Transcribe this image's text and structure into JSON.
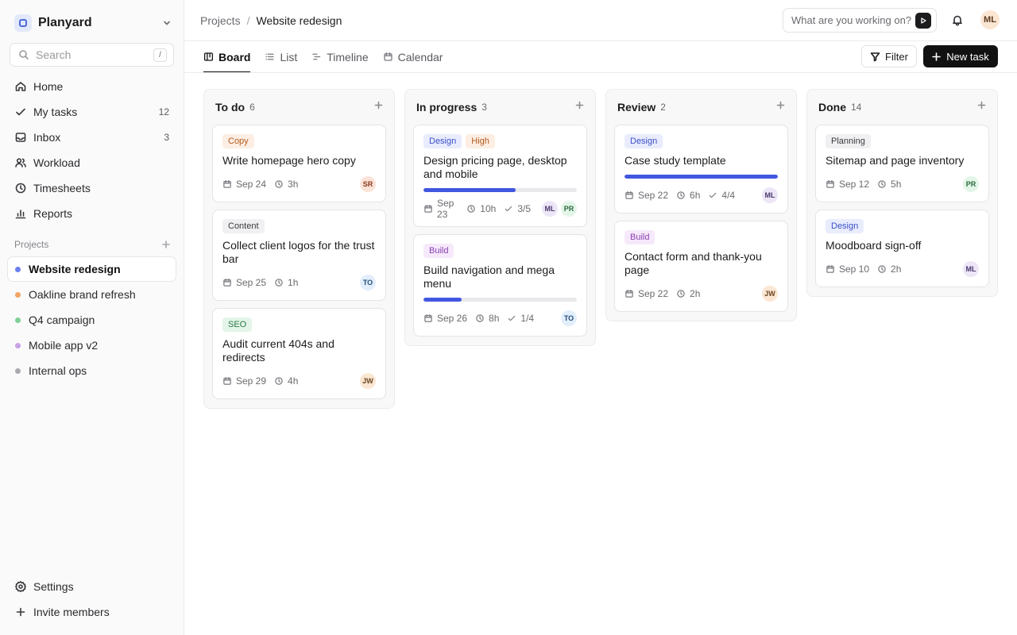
{
  "workspace": {
    "name": "Planyard",
    "logo_icon": "square-logo-icon"
  },
  "search": {
    "placeholder": "Search",
    "shortcut": "/"
  },
  "nav": [
    {
      "label": "Home",
      "icon": "home-icon"
    },
    {
      "label": "My tasks",
      "icon": "check-icon",
      "count": "12"
    },
    {
      "label": "Inbox",
      "icon": "inbox-icon",
      "count": "3"
    },
    {
      "label": "Workload",
      "icon": "users-icon"
    },
    {
      "label": "Timesheets",
      "icon": "clock-icon"
    },
    {
      "label": "Reports",
      "icon": "bar-chart-icon"
    }
  ],
  "projects_section": {
    "label": "Projects"
  },
  "projects": [
    {
      "name": "Website redesign",
      "color": "#6b7ff0",
      "active": true
    },
    {
      "name": "Oakline brand refresh",
      "color": "#f0a467",
      "active": false
    },
    {
      "name": "Q4 campaign",
      "color": "#7fcf96",
      "active": false
    },
    {
      "name": "Mobile app v2",
      "color": "#c7a2e6",
      "active": false
    },
    {
      "name": "Internal ops",
      "color": "#a9a9ae",
      "active": false
    }
  ],
  "bottom_nav": [
    {
      "label": "Settings",
      "icon": "gear-icon"
    },
    {
      "label": "Invite members",
      "icon": "plus-icon"
    }
  ],
  "breadcrumb": {
    "parent": "Projects",
    "separator": "/",
    "current": "Website redesign"
  },
  "timer": {
    "placeholder": "What are you working on?"
  },
  "user": {
    "initials": "ML"
  },
  "tabs": [
    {
      "label": "Board",
      "icon": "board-icon",
      "active": true
    },
    {
      "label": "List",
      "icon": "list-icon",
      "active": false
    },
    {
      "label": "Timeline",
      "icon": "timeline-icon",
      "active": false
    },
    {
      "label": "Calendar",
      "icon": "calendar-icon",
      "active": false
    }
  ],
  "actions": {
    "filter": "Filter",
    "new_task": "New task"
  },
  "tag_colors": {
    "Copy": {
      "bg": "#fdeee3",
      "fg": "#b25a1c"
    },
    "Content": {
      "bg": "#f0f0f2",
      "fg": "#3a3a3e"
    },
    "SEO": {
      "bg": "#e3f5e8",
      "fg": "#2d7a45"
    },
    "Design": {
      "bg": "#e8ecfd",
      "fg": "#3d50c9"
    },
    "High": {
      "bg": "#fdeee3",
      "fg": "#b25a1c"
    },
    "Build": {
      "bg": "#f6e9fb",
      "fg": "#8a3fb0"
    },
    "Planning": {
      "bg": "#f0f0f2",
      "fg": "#3a3a3e"
    }
  },
  "avatar_colors": {
    "SR": {
      "bg": "#fbe3d8",
      "fg": "#8a3b1e"
    },
    "TO": {
      "bg": "#e2eefb",
      "fg": "#274e7a"
    },
    "JW": {
      "bg": "#fbe6d3",
      "fg": "#6a4520"
    },
    "ML": {
      "bg": "#ece6f7",
      "fg": "#4b3a6e"
    },
    "PR": {
      "bg": "#e3f5e8",
      "fg": "#2d6b3e"
    }
  },
  "columns": [
    {
      "title": "To do",
      "count": "6",
      "cards": [
        {
          "tags": [
            "Copy"
          ],
          "title": "Write homepage hero copy",
          "date": "Sep 24",
          "estimate": "3h",
          "assignees": [
            "SR"
          ]
        },
        {
          "tags": [
            "Content"
          ],
          "title": "Collect client logos for the trust bar",
          "date": "Sep 25",
          "estimate": "1h",
          "assignees": [
            "TO"
          ]
        },
        {
          "tags": [
            "SEO"
          ],
          "title": "Audit current 404s and redirects",
          "date": "Sep 29",
          "estimate": "4h",
          "assignees": [
            "JW"
          ]
        }
      ]
    },
    {
      "title": "In progress",
      "count": "3",
      "cards": [
        {
          "tags": [
            "Design",
            "High"
          ],
          "title": "Design pricing page, desktop and mobile",
          "progress": 0.6,
          "date": "Sep 23",
          "estimate": "10h",
          "subtasks": "3/5",
          "assignees": [
            "ML",
            "PR"
          ]
        },
        {
          "tags": [
            "Build"
          ],
          "title": "Build navigation and mega menu",
          "progress": 0.25,
          "date": "Sep 26",
          "estimate": "8h",
          "subtasks": "1/4",
          "assignees": [
            "TO"
          ]
        }
      ]
    },
    {
      "title": "Review",
      "count": "2",
      "cards": [
        {
          "tags": [
            "Design"
          ],
          "title": "Case study template",
          "progress": 1.0,
          "date": "Sep 22",
          "estimate": "6h",
          "subtasks": "4/4",
          "assignees": [
            "ML"
          ]
        },
        {
          "tags": [
            "Build"
          ],
          "title": "Contact form and thank-you page",
          "date": "Sep 22",
          "estimate": "2h",
          "assignees": [
            "JW"
          ]
        }
      ]
    },
    {
      "title": "Done",
      "count": "14",
      "cards": [
        {
          "tags": [
            "Planning"
          ],
          "title": "Sitemap and page inventory",
          "date": "Sep 12",
          "estimate": "5h",
          "assignees": [
            "PR"
          ]
        },
        {
          "tags": [
            "Design"
          ],
          "title": "Moodboard sign-off",
          "date": "Sep 10",
          "estimate": "2h",
          "assignees": [
            "ML"
          ]
        }
      ]
    }
  ]
}
